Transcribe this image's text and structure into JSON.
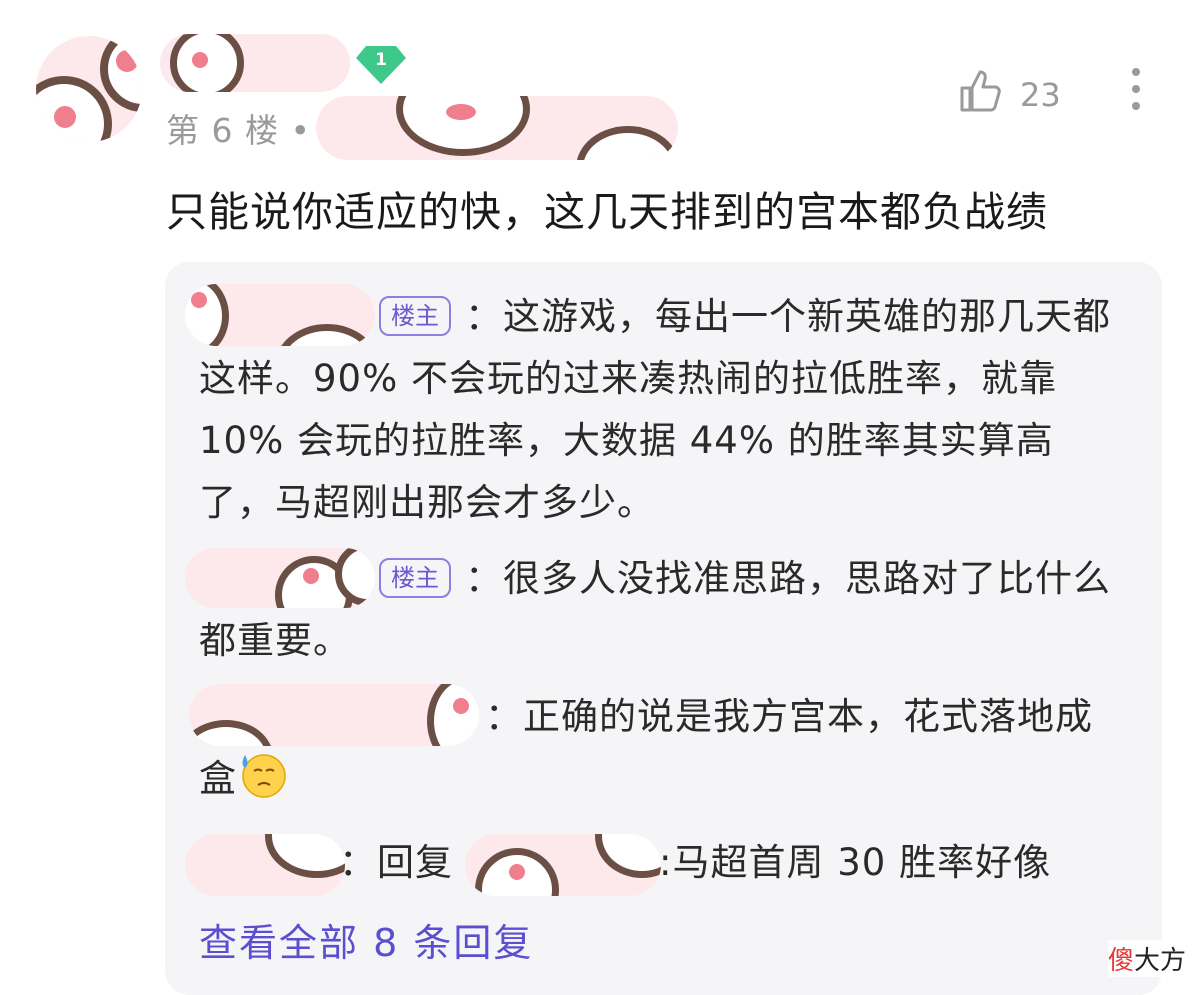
{
  "comment": {
    "floor_label": "第 6 楼 •",
    "level": "1",
    "like_count": "23",
    "text": "只能说你适应的快，这几天排到的宫本都负战绩"
  },
  "replies": [
    {
      "owner_tag": "楼主",
      "text": "：这游戏，每出一个新英雄的那几天都这样。90% 不会玩的过来凑热闹的拉低胜率，就靠 10% 会玩的拉胜率，大数据 44% 的胜率其实算高了，马超刚出那会才多少。"
    },
    {
      "owner_tag": "楼主",
      "text": "：很多人没找准思路，思路对了比什么都重要。"
    },
    {
      "text": "：正确的说是我方宫本，花式落地成盒",
      "emoji": "sweat-smile-emoji"
    },
    {
      "prefix": "：回复",
      "text": ":马超首周 30 胜率好像"
    }
  ],
  "view_all_label": "查看全部 8 条回复",
  "watermark": {
    "accent": "傻",
    "rest": "大方"
  },
  "colors": {
    "link": "#5b4fcf",
    "owner_tag": "#6a5acd",
    "level_badge": "#3ec98a"
  }
}
